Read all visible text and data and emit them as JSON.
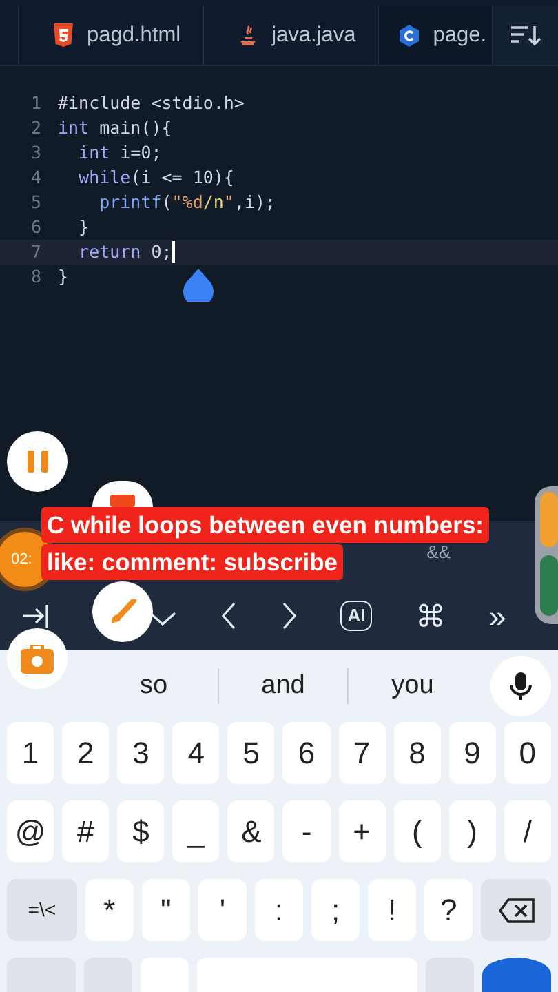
{
  "tabs": [
    {
      "label": "pagd.html",
      "kind": "html",
      "selected": false
    },
    {
      "label": "java.java",
      "kind": "java",
      "selected": false
    },
    {
      "label": "page.",
      "kind": "c",
      "selected": true
    }
  ],
  "code_lines": [
    {
      "number": "1",
      "current": false,
      "tokens": [
        {
          "kind": "plain",
          "text": "#include <stdio.h>"
        }
      ]
    },
    {
      "number": "2",
      "current": false,
      "tokens": [
        {
          "kind": "keyword",
          "text": "int"
        },
        {
          "kind": "plain",
          "text": " main(){"
        }
      ],
      "children": [
        {
          "number": "3",
          "current": false,
          "tokens": [
            {
              "kind": "keyword",
              "text": "int"
            },
            {
              "kind": "plain",
              "text": " i=0;"
            }
          ]
        },
        {
          "number": "4",
          "current": false,
          "tokens": [
            {
              "kind": "keyword",
              "text": "while"
            },
            {
              "kind": "plain",
              "text": "(i <= 10){"
            }
          ],
          "children": [
            {
              "number": "5",
              "current": false,
              "tokens": [
                {
                  "kind": "function",
                  "text": "printf"
                },
                {
                  "kind": "plain",
                  "text": "("
                },
                {
                  "kind": "string",
                  "text": "\"%d"
                },
                {
                  "kind": "escape",
                  "text": "/n"
                },
                {
                  "kind": "string",
                  "text": "\""
                },
                {
                  "kind": "plain",
                  "text": ",i);"
                }
              ]
            }
          ]
        },
        {
          "number": "6",
          "current": false,
          "tokens": [
            {
              "kind": "plain",
              "text": "}"
            }
          ]
        },
        {
          "number": "7",
          "current": true,
          "tokens": [
            {
              "kind": "keyword",
              "text": "return"
            },
            {
              "kind": "plain",
              "text": " 0;"
            }
          ]
        }
      ]
    },
    {
      "number": "8",
      "current": false,
      "tokens": [
        {
          "kind": "plain",
          "text": "}"
        }
      ]
    }
  ],
  "caption": {
    "lines": [
      "C while loops between even numbers:",
      "like: comment: subscribe"
    ]
  },
  "timer": "02:",
  "symbols": [
    "&&"
  ],
  "toolbar": [
    {
      "kind": "tab"
    },
    {
      "kind": "collapse"
    },
    {
      "kind": "left"
    },
    {
      "kind": "right"
    },
    {
      "kind": "badge",
      "text": "AI"
    },
    {
      "kind": "glyph",
      "text": "⌘"
    },
    {
      "kind": "glyph",
      "text": "»"
    }
  ],
  "suggestions": [
    "so",
    "and",
    "you"
  ],
  "keys": [
    [
      {
        "kind": "key",
        "text": "1"
      },
      {
        "kind": "key",
        "text": "2"
      },
      {
        "kind": "key",
        "text": "3"
      },
      {
        "kind": "key",
        "text": "4"
      },
      {
        "kind": "key",
        "text": "5"
      },
      {
        "kind": "key",
        "text": "6"
      },
      {
        "kind": "key",
        "text": "7"
      },
      {
        "kind": "key",
        "text": "8"
      },
      {
        "kind": "key",
        "text": "9"
      },
      {
        "kind": "key",
        "text": "0"
      }
    ],
    [
      {
        "kind": "key",
        "text": "@"
      },
      {
        "kind": "key",
        "text": "#"
      },
      {
        "kind": "key",
        "text": "$"
      },
      {
        "kind": "key",
        "text": "_"
      },
      {
        "kind": "key",
        "text": "&"
      },
      {
        "kind": "key",
        "text": "-"
      },
      {
        "kind": "key",
        "text": "+"
      },
      {
        "kind": "key",
        "text": "("
      },
      {
        "kind": "key",
        "text": ")"
      },
      {
        "kind": "key",
        "text": "/"
      }
    ],
    [
      {
        "kind": "mod",
        "text": "=\\<"
      },
      {
        "kind": "key",
        "text": "*"
      },
      {
        "kind": "key",
        "text": "\""
      },
      {
        "kind": "key",
        "text": "'"
      },
      {
        "kind": "key",
        "text": ":"
      },
      {
        "kind": "key",
        "text": ";"
      },
      {
        "kind": "key",
        "text": "!"
      },
      {
        "kind": "key",
        "text": "?"
      },
      {
        "kind": "backspace"
      }
    ]
  ]
}
